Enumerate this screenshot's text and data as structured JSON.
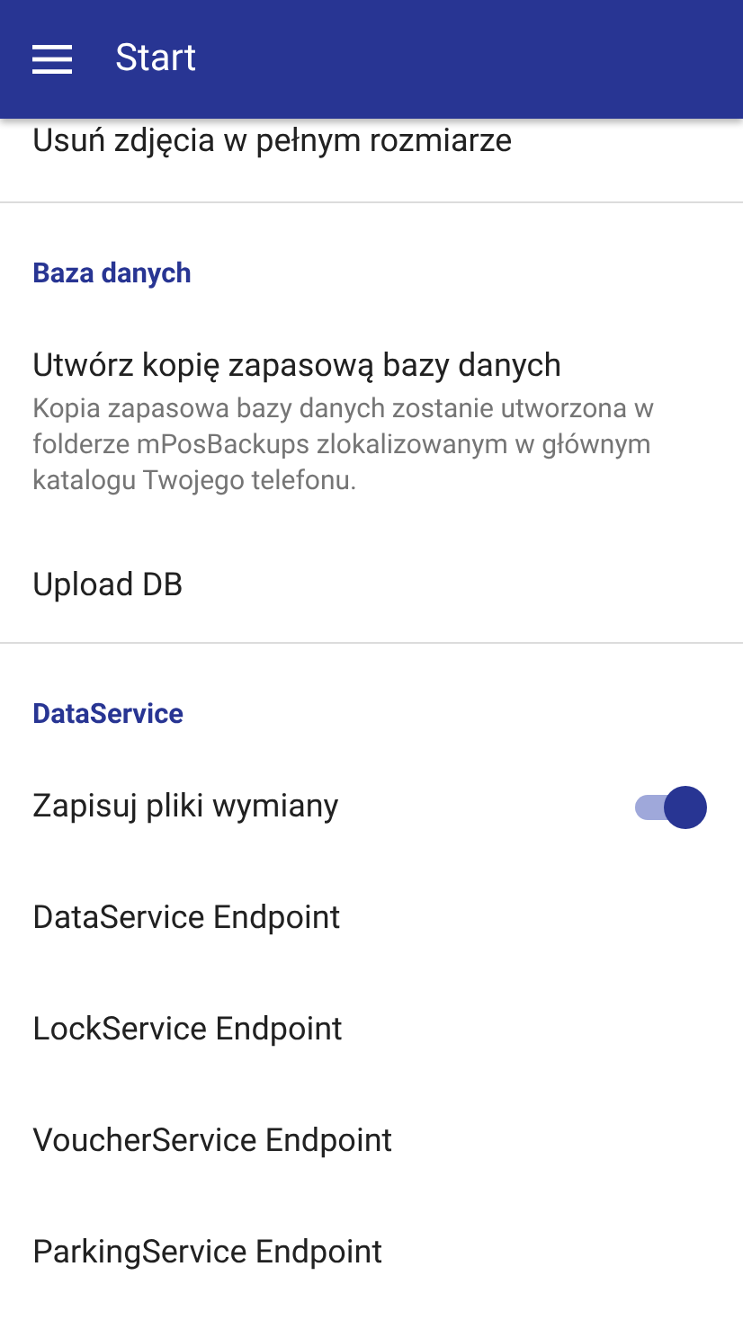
{
  "app_bar": {
    "title": "Start"
  },
  "groups": [
    {
      "items": [
        {
          "kind": "plain",
          "title": "Usuń zdjęcia w pełnym rozmiarze"
        }
      ]
    },
    {
      "category": "Baza danych",
      "items": [
        {
          "kind": "plain",
          "title": "Utwórz kopię zapasową bazy danych",
          "summary": "Kopia zapasowa bazy danych zostanie utworzona w folderze mPosBackups zlokalizowanym w głównym katalogu Twojego telefonu."
        },
        {
          "kind": "plain",
          "title": "Upload DB"
        }
      ]
    },
    {
      "category": "DataService",
      "items": [
        {
          "kind": "switch",
          "title": "Zapisuj pliki wymiany",
          "on": true
        },
        {
          "kind": "plain",
          "title": "DataService Endpoint"
        },
        {
          "kind": "plain",
          "title": "LockService Endpoint"
        },
        {
          "kind": "plain",
          "title": "VoucherService Endpoint"
        },
        {
          "kind": "plain",
          "title": "ParkingService Endpoint"
        }
      ]
    }
  ]
}
